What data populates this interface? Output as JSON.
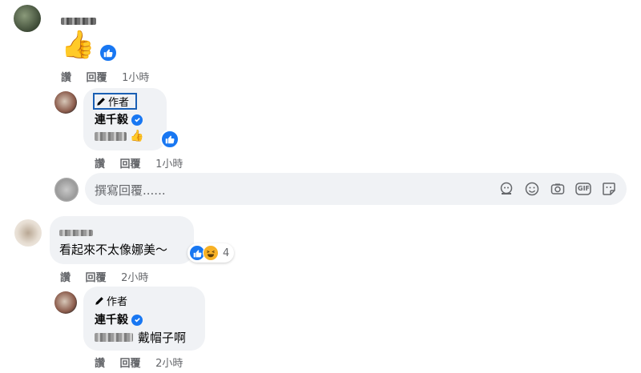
{
  "comments": [
    {
      "author_label": "",
      "reply": {
        "author_tag": "作者",
        "name": "連千毅",
        "text_suffix": "👍"
      },
      "actions": {
        "like": "讚",
        "reply": "回覆",
        "time": "1小時"
      },
      "reply_actions": {
        "like": "讚",
        "reply": "回覆",
        "time": "1小時"
      },
      "emoji": "👍"
    },
    {
      "text": "看起來不太像娜美～",
      "reaction_count": "4",
      "actions": {
        "like": "讚",
        "reply": "回覆",
        "time": "2小時"
      },
      "reply": {
        "author_tag": "作者",
        "name": "連千毅",
        "text": "戴帽子啊"
      },
      "reply_actions": {
        "like": "讚",
        "reply": "回覆",
        "time": "2小時"
      }
    }
  ],
  "composer": {
    "placeholder": "撰寫回覆......",
    "gif_label": "GIF"
  },
  "colors": {
    "accent": "#1877f2",
    "bubble": "#f0f2f5",
    "meta": "#65676b"
  }
}
